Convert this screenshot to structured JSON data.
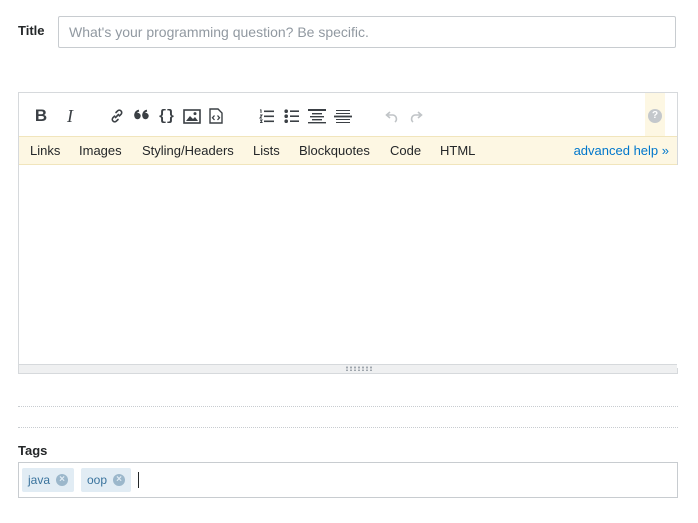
{
  "title": {
    "label": "Title",
    "placeholder": "What's your programming question? Be specific.",
    "value": ""
  },
  "editor": {
    "toolbar": {
      "buttons": [
        {
          "name": "bold",
          "glyph": "B",
          "enabled": true
        },
        {
          "name": "italic",
          "glyph": "I",
          "enabled": true
        },
        {
          "name": "link",
          "icon": "link-icon",
          "enabled": true
        },
        {
          "name": "blockquote",
          "glyph": "66",
          "enabled": true
        },
        {
          "name": "code",
          "glyph": "{}",
          "enabled": true
        },
        {
          "name": "image",
          "icon": "image-icon",
          "enabled": true
        },
        {
          "name": "snippet",
          "icon": "snippet-icon",
          "enabled": true
        },
        {
          "name": "numbered-list",
          "icon": "numbered-list-icon",
          "enabled": true
        },
        {
          "name": "bulleted-list",
          "icon": "bulleted-list-icon",
          "enabled": true
        },
        {
          "name": "heading",
          "icon": "heading-icon",
          "enabled": true
        },
        {
          "name": "horizontal-rule",
          "icon": "horizontal-rule-icon",
          "enabled": true
        },
        {
          "name": "undo",
          "icon": "undo-icon",
          "enabled": false
        },
        {
          "name": "redo",
          "icon": "redo-icon",
          "enabled": false
        }
      ],
      "help_glyph": "?"
    },
    "help_tabs": [
      "Links",
      "Images",
      "Styling/Headers",
      "Lists",
      "Blockquotes",
      "Code",
      "HTML"
    ],
    "advanced_help": "advanced help »",
    "body": ""
  },
  "tags": {
    "label": "Tags",
    "items": [
      {
        "name": "java"
      },
      {
        "name": "oop"
      }
    ],
    "remove_glyph": "×"
  },
  "colors": {
    "link": "#0077cc",
    "help_bar_bg": "#fdf7e3",
    "tag_bg": "#e1ecf4",
    "tag_text": "#39739d"
  }
}
